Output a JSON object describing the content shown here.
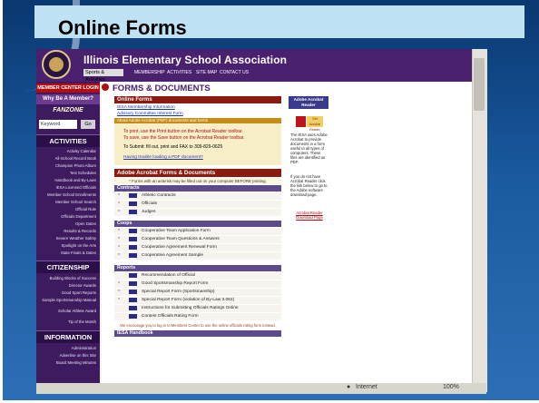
{
  "slide": {
    "title": "Online Forms"
  },
  "site": {
    "title": "Illinois Elementary School Association",
    "nav_select": "Sports & Activities",
    "nav_links": [
      "MEMBERSHIP",
      "ACTIVITIES",
      "SITE MAP",
      "CONTACT US"
    ]
  },
  "sidebar": {
    "login": "MEMBER CENTER LOGIN",
    "member": "Why Be A Member?",
    "fanzone": "FANZONE",
    "keyword_placeholder": "Keyword",
    "go": "Go",
    "activities_header": "ACTIVITIES",
    "activities": [
      "Activity Calendar",
      "All-School Record Book",
      "Champion Photo Album",
      "Test Schedules",
      "Handbook and By-Laws",
      "IESA Licensed Officials",
      "Member School Enrollments",
      "Member School Search",
      "Official Rule",
      "Officials Department",
      "Open Dates",
      "Results & Records",
      "Severe Weather Safety",
      "Spotlight on the Arts",
      "State Finals & Dates"
    ],
    "citizenship_header": "CITIZENSHIP",
    "citizenship": [
      "Building Blocks of Success",
      "Director Awards",
      "Good Sport Reports",
      "Sample Sportsmanship Manual",
      "Scholar Athlete Award",
      "Tip of the Month"
    ],
    "information_header": "INFORMATION",
    "information": [
      "Administration",
      "Advertise on this Site",
      "Board Meeting Minutes"
    ]
  },
  "content": {
    "heading": "FORMS & DOCUMENTS",
    "online_forms": {
      "header": "Online Forms",
      "links": [
        "IESA Membership Information",
        "Advisory Committee Interest Form"
      ],
      "gold_note": "About Adobe Acrobat (PDF) documents and forms",
      "instructions": [
        "To print, use the Print button on the Acrobat Reader toolbar.",
        "To save, use the Save button on the Acrobat Reader toolbar."
      ],
      "submit": "To Submit: fill out, print and FAX to 309-829-0625",
      "trouble_link": "Having trouble loading a PDF document?"
    },
    "acrobat": {
      "header": "Adobe Acrobat Forms & Documents",
      "note": "* Forms with an asterisk may be filled out on your computer BEFORE printing."
    },
    "sections": [
      {
        "title": "Contracts",
        "rows": [
          {
            "star": "*",
            "label": "Athletic Contracts"
          },
          {
            "star": "*",
            "label": "Officials"
          },
          {
            "star": "*",
            "label": "Judges"
          }
        ]
      },
      {
        "title": "Coops",
        "rows": [
          {
            "star": "*",
            "label": "Cooperative Team Application Form"
          },
          {
            "star": "*",
            "label": "Cooperative Team Questions & Answers"
          },
          {
            "star": "*",
            "label": "Cooperative Agreement Renewal Form"
          },
          {
            "star": "*",
            "label": "Cooperative Agreement Sample"
          }
        ]
      },
      {
        "title": "Reports",
        "rows": [
          {
            "star": "",
            "label": "Recommendation of Official"
          },
          {
            "star": "*",
            "label": "Good Sportsmanship Report Form"
          },
          {
            "star": "*",
            "label": "Special Report Form (Sportsmanship)"
          },
          {
            "star": "*",
            "label": "Special Report Form (violation of By-Law 3.062)"
          },
          {
            "star": "",
            "label": "Instructions for Submitting Officials Ratings Online"
          },
          {
            "star": "",
            "label": "Contest Officials Rating Form"
          }
        ]
      }
    ],
    "footnote": "We encourage you to log in to Members Center to use the online officials rating form instead.",
    "handbook_header": "IESA Handbook"
  },
  "rightcol": {
    "header": "Adobe Acrobat Reader",
    "badge": "Get Acrobat Reader",
    "text1": "The IESA uses Adobe Acrobat to provide documents in a form useful to all types of computers. These files are identified as PDF.",
    "text2": "If you do not have Acrobat Reader click the link below to go to the Adobe software download page.",
    "download": "Acrobat Reader Download Page"
  },
  "status": {
    "zone": "Internet",
    "zoom": "100%"
  },
  "colors": {
    "purple": "#4a216f",
    "red": "#b10d12",
    "gold": "#c68b18"
  }
}
